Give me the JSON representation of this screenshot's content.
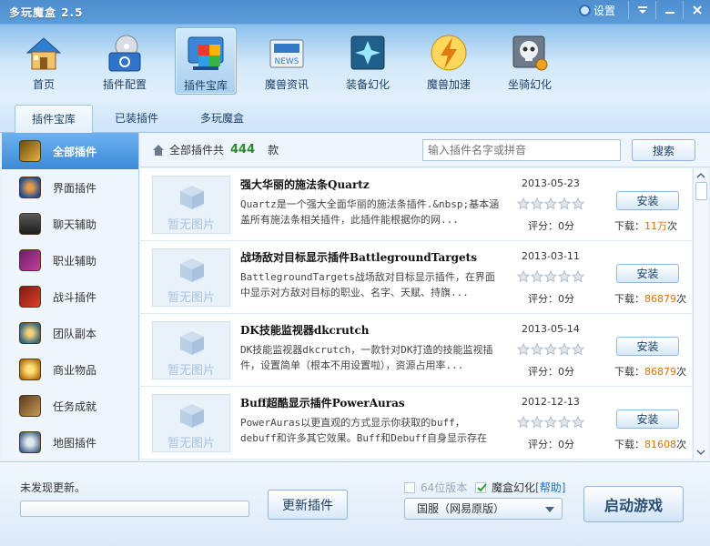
{
  "app": {
    "title": "多玩魔盒 2.5",
    "settings_label": "设置"
  },
  "nav": {
    "items": [
      {
        "label": "首页",
        "icon": "house-icon",
        "active": false
      },
      {
        "label": "插件配置",
        "icon": "disc-settings-icon",
        "active": false
      },
      {
        "label": "插件宝库",
        "icon": "plugin-store-icon",
        "active": true
      },
      {
        "label": "魔兽资讯",
        "icon": "news-icon",
        "active": false
      },
      {
        "label": "装备幻化",
        "icon": "transmog-icon",
        "active": false
      },
      {
        "label": "魔兽加速",
        "icon": "lightning-icon",
        "active": false
      },
      {
        "label": "坐骑幻化",
        "icon": "mount-skull-icon",
        "active": false
      }
    ]
  },
  "subtabs": [
    {
      "label": "插件宝库",
      "active": true
    },
    {
      "label": "已装插件",
      "active": false
    },
    {
      "label": "多玩魔盒",
      "active": false
    }
  ],
  "sidebar": {
    "items": [
      {
        "label": "全部插件",
        "icon": "all-plugins-icon",
        "active": true
      },
      {
        "label": "界面插件",
        "icon": "ui-plugin-icon",
        "active": false
      },
      {
        "label": "聊天辅助",
        "icon": "chat-helmet-icon",
        "active": false
      },
      {
        "label": "职业辅助",
        "icon": "class-swords-icon",
        "active": false
      },
      {
        "label": "战斗插件",
        "icon": "combat-icon",
        "active": false
      },
      {
        "label": "团队副本",
        "icon": "raid-icon",
        "active": false
      },
      {
        "label": "商业物品",
        "icon": "gold-coins-icon",
        "active": false
      },
      {
        "label": "任务成就",
        "icon": "quest-scroll-icon",
        "active": false
      },
      {
        "label": "地图插件",
        "icon": "map-icon",
        "active": false
      }
    ]
  },
  "main": {
    "header_prefix": "全部插件共",
    "count": "444",
    "header_suffix": "款",
    "search_placeholder": "输入插件名字或拼音",
    "search_button": "搜索"
  },
  "plugins": [
    {
      "name": "强大华丽的施法条Quartz",
      "desc": "Quartz是一个强大全面华丽的施法条插件.&nbsp;基本涵盖所有施法条相关插件，此插件能根据你的网...",
      "date": "2013-05-23",
      "score_label": "评分：0分",
      "downloads_prefix": "下载：",
      "downloads": "11万",
      "downloads_suffix": "次",
      "thumb_text": "暂无图片",
      "install_label": "安装",
      "rating": 0
    },
    {
      "name": "战场敌对目标显示插件BattlegroundTargets",
      "desc": "BattlegroundTargets战场敌对目标显示插件，在界面中显示对方敌对目标的职业、名字、天赋、持旗...",
      "date": "2013-03-11",
      "score_label": "评分：0分",
      "downloads_prefix": "下载：",
      "downloads": "86879",
      "downloads_suffix": "次",
      "thumb_text": "暂无图片",
      "install_label": "安装",
      "rating": 0
    },
    {
      "name": "DK技能监视器dkcrutch",
      "desc": "DK技能监视器dkcrutch，一款针对DK打造的技能监视插件，设置简单（根本不用设置啦），资源占用率...",
      "date": "2013-05-14",
      "score_label": "评分：0分",
      "downloads_prefix": "下载：",
      "downloads": "86879",
      "downloads_suffix": "次",
      "thumb_text": "暂无图片",
      "install_label": "安装",
      "rating": 0
    },
    {
      "name": "Buff超酷显示插件PowerAuras",
      "desc": "PowerAuras以更直观的方式显示你获取的buff，debuff和许多其它效果。Buff和Debuff自身显示存在不...",
      "date": "2012-12-13",
      "score_label": "评分：0分",
      "downloads_prefix": "下载：",
      "downloads": "81608",
      "downloads_suffix": "次",
      "thumb_text": "暂无图片",
      "install_label": "安装",
      "rating": 0
    }
  ],
  "footer": {
    "status": "未发现更新。",
    "progress": 0,
    "update_button": "更新插件",
    "x64_label": "64位版本",
    "x64_checked": false,
    "transmog_label": "魔盒幻化",
    "transmog_checked": true,
    "help_label": "[帮助]",
    "server_selected": "国服（网易原版）",
    "start_button": "启动游戏"
  },
  "colors": {
    "accent": "#3c8ad9",
    "count_green": "#2b8a2b",
    "downloads_orange": "#e07000"
  }
}
